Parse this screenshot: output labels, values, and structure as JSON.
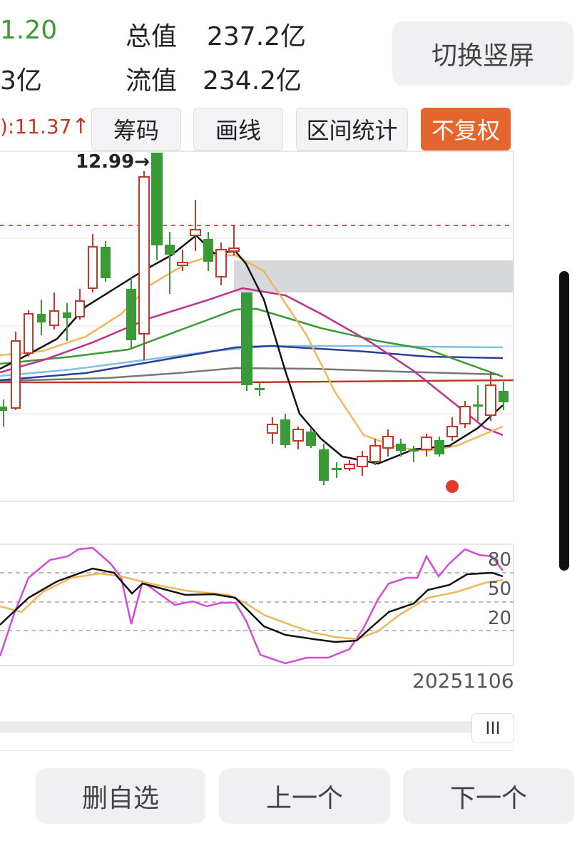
{
  "header": {
    "change_fragment": "1.20",
    "volume_fragment": "3亿",
    "total_value_label": "总值",
    "total_value": "237.2亿",
    "float_value_label": "流值",
    "float_value": "234.2亿",
    "switch_button": "切换竖屏"
  },
  "toolbar": {
    "price_readout": "):11.37",
    "arrow": "↑",
    "chips_button": "筹码",
    "draw_button": "画线",
    "range_stats_button": "区间统计",
    "adjust_button": "不复权"
  },
  "main_chart": {
    "high_label": "12.99",
    "high_arrow": "→"
  },
  "indicator": {
    "level_80": "80",
    "level_50": "50",
    "level_20": "20"
  },
  "date_label": "20251106",
  "scroller_handle": "III",
  "bottom": {
    "remove_button": "删自选",
    "prev_button": "上一个",
    "next_button": "下一个"
  },
  "colors": {
    "up": "#c0392b",
    "down": "#3a9a35",
    "accent": "#e2662e",
    "k_line": "#d44ad8",
    "d_line": "#f0b75a",
    "j_line": "#111111"
  }
}
